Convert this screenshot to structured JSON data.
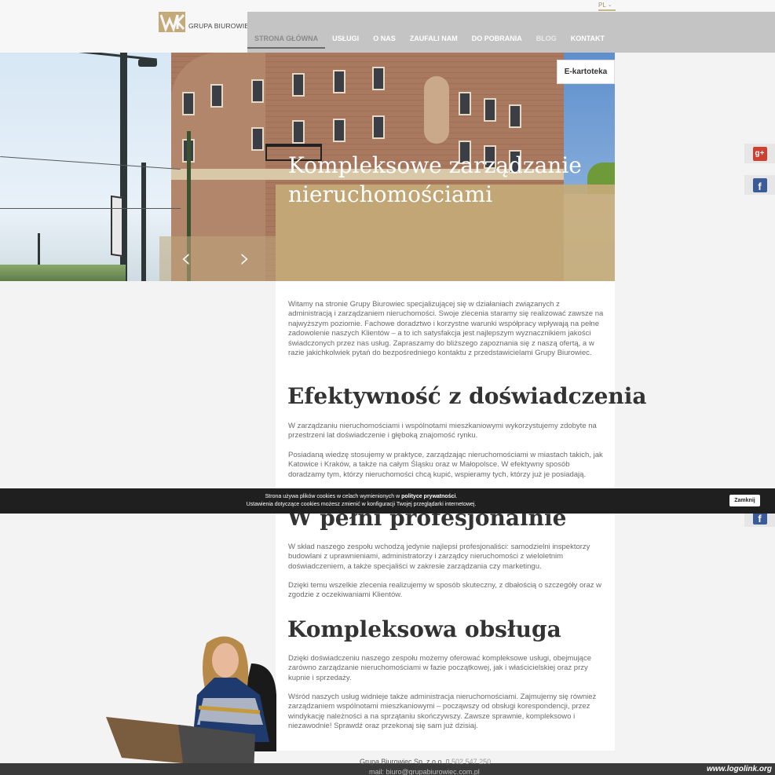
{
  "language": {
    "current": "PL"
  },
  "logo": {
    "text": "GRUPA BIUROWIEC"
  },
  "nav": {
    "items": [
      {
        "label": "STRONA GŁÓWNA"
      },
      {
        "label": "USŁUGI"
      },
      {
        "label": "O NAS"
      },
      {
        "label": "ZAUFALI NAM"
      },
      {
        "label": "DO POBRANIA"
      },
      {
        "label": "BLOG"
      },
      {
        "label": "KONTAKT"
      }
    ]
  },
  "hero": {
    "title_line1": "Kompleksowe zarządzanie",
    "title_line2": "nieruchomościami",
    "prev_arrow": "‹",
    "next_arrow": "›",
    "ekartoteka_label": "E-kartoteka"
  },
  "social": {
    "gplus_label": "g+",
    "facebook_label": "f"
  },
  "content": {
    "intro": "Witamy na stronie Grupy Biurowiec specjalizującej się w działaniach związanych z administracją i zarządzaniem nieruchomości. Swoje zlecenia staramy się realizować zawsze na najwyższym poziomie. Fachowe doradztwo i korzystne warunki współpracy wpływają na pełne zadowolenie naszych Klientów – a to ich satysfakcja jest najlepszym wyznacznikiem jakości świadczonych przez nas usług. Zapraszamy do bliższego zapoznania się z naszą ofertą, a w razie jakichkolwiek pytań do bezpośredniego kontaktu z przedstawicielami Grupy Biurowiec.",
    "section1_title": "Efektywność z doświadczenia",
    "section1_p1": "W zarządzaniu nieruchomościami i wspólnotami mieszkaniowymi wykorzystujemy zdobyte na przestrzeni lat doświadczenie i głęboką znajomość rynku.",
    "section1_p2": "Posiadaną wiedzę stosujemy w praktyce, zarządzając nieruchomościami w miastach takich, jak Katowice i Kraków, a także na całym Śląsku oraz w Małopolsce. W efektywny sposób doradzamy tym, którzy nieruchomości chcą kupić, wspieramy tych, którzy już je posiadają.",
    "section2_title": "W pełni profesjonalnie",
    "section2_p1": "W skład naszego zespołu wchodzą jedynie najlepsi profesjonaliści: samodzielni inspektorzy budowlani z uprawnieniami, administratorzy i zarządcy nieruchomości z wieloletnim doświadczeniem, a także specjaliści w zakresie zarządzania czy marketingu.",
    "section2_p2": "Dzięki temu wszelkie zlecenia realizujemy w sposób skuteczny, z dbałością o szczegóły oraz w zgodzie z oczekiwaniami Klientów.",
    "section3_title": "Kompleksowa obsługa",
    "section3_p1": "Dzięki doświadczeniu naszego zespołu możemy oferować kompleksowe usługi, obejmujące zarówno zarządzanie nieruchomościami w fazie początkowej, jak i właścicielskiej oraz przy kupnie i sprzedaży.",
    "section3_p2": "Wśród naszych usług widnieje także administracja nieruchomościami. Zajmujemy się również zarządzaniem wspólnotami mieszkaniowymi – począwszy od obsługi korespondencji, przez windykację należności a na sprzątaniu skończywszy. Zawsze sprawnie, kompleksowo i niezawodnie! Sprawdź oraz przekonaj się sam już dzisiaj."
  },
  "cookie": {
    "line1_before": "Strona używa plików cookies w celach wymienionych w ",
    "line1_link": "polityce prywatności",
    "line1_after": ".",
    "line2": "Ustawienia dotyczące cookies możesz zmienić w konfiguracji Twojej przeglądarki internetowej.",
    "close_label": "Zamknij"
  },
  "footer": {
    "company": "Grupa Biurowiec Sp. z o.o.",
    "phone": "502 547 250",
    "email": "mail: biuro@grupabiurowiec.com.pl"
  },
  "watermark": "www.logolink.org",
  "colors": {
    "accent_gold": "#c4aa78",
    "nav_bg": "#c4c4c4",
    "cookie_bg": "#1f1f1f"
  }
}
